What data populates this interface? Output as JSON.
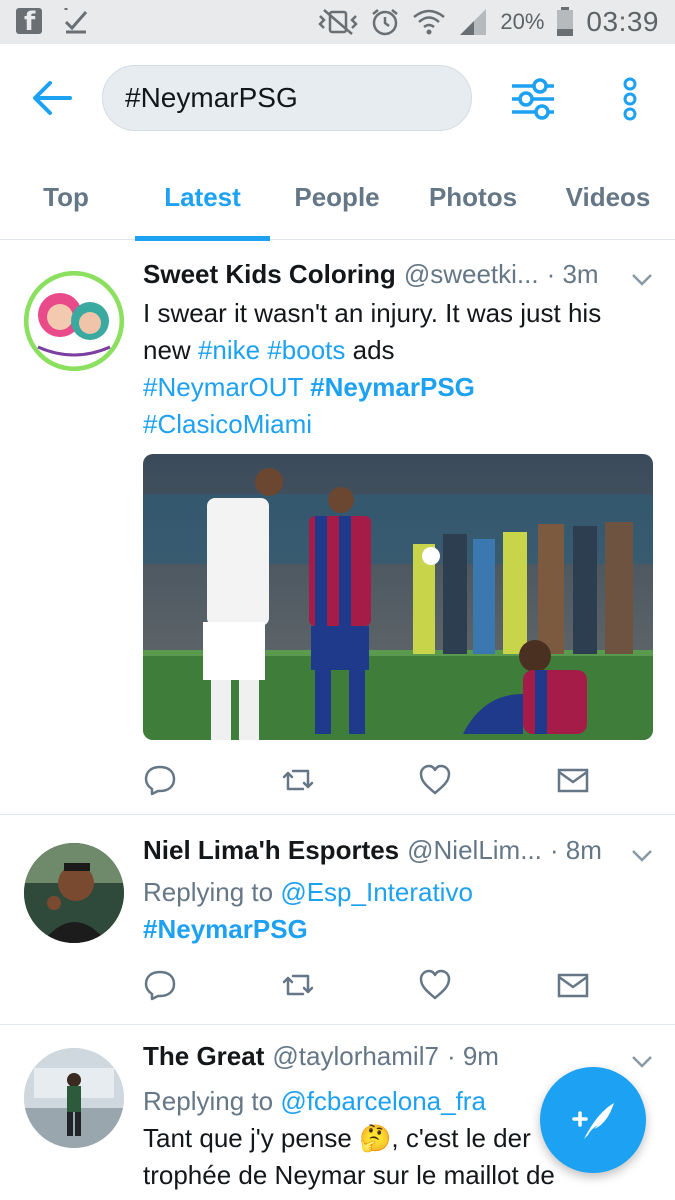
{
  "status_bar": {
    "battery_pct": "20%",
    "time": "03:39",
    "icons": [
      "facebook-icon",
      "check-icon",
      "vibrate-icon",
      "alarm-icon",
      "wifi-icon",
      "signal-icon",
      "battery-icon"
    ]
  },
  "search": {
    "query": "#NeymarPSG"
  },
  "tabs": [
    {
      "label": "Top"
    },
    {
      "label": "Latest",
      "active": true
    },
    {
      "label": "People"
    },
    {
      "label": "Photos"
    },
    {
      "label": "Videos"
    }
  ],
  "tweets": [
    {
      "name": "Sweet Kids Coloring",
      "handle": "@sweetki...",
      "time": "· 3m",
      "text_plain": "I swear it wasn't an injury. It was just his new",
      "hashtags": [
        "#nike",
        "#boots"
      ],
      "text_after": "ads",
      "hashtags2": [
        "#NeymarOUT",
        "#NeymarPSG",
        "#ClasicoMiami"
      ],
      "has_photo": true
    },
    {
      "name": "Niel Lima'h Esportes",
      "handle": "@NielLim...",
      "time": "· 8m",
      "replying_prefix": "Replying to",
      "replying_to": "@Esp_Interativo",
      "hashtag": "#NeymarPSG"
    },
    {
      "name": "The Great",
      "handle": "@taylorhamil7",
      "time": "· 9m",
      "replying_prefix": "Replying to",
      "replying_to": "@fcbarcelona_fra",
      "line1": "Tant que j'y pense 🤔, c'est le der",
      "line2": "trophée de Neymar sur le maillot de"
    }
  ],
  "colors": {
    "accent": "#1da1f2",
    "muted": "#657786",
    "text": "#14171a"
  }
}
